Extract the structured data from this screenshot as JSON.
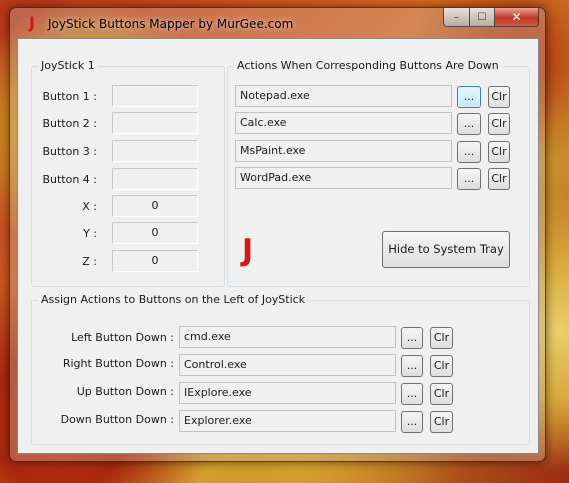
{
  "window": {
    "title": "JoyStick Buttons Mapper by MurGee.com",
    "app_icon": "J"
  },
  "caption": {
    "minimize": "–",
    "maximize": "☐",
    "close": "✕"
  },
  "joystick": {
    "label": "JoyStick 1",
    "buttons": [
      "Button 1 :",
      "Button 2 :",
      "Button 3 :",
      "Button 4 :"
    ],
    "axes": [
      {
        "label": "X :",
        "value": "0"
      },
      {
        "label": "Y :",
        "value": "0"
      },
      {
        "label": "Z :",
        "value": "0"
      }
    ]
  },
  "actions": {
    "label": "Actions When Corresponding Buttons Are Down",
    "rows": [
      {
        "value": "Notepad.exe",
        "browse": "...",
        "clear": "Clr"
      },
      {
        "value": "Calc.exe",
        "browse": "...",
        "clear": "Clr"
      },
      {
        "value": "MsPaint.exe",
        "browse": "...",
        "clear": "Clr"
      },
      {
        "value": "WordPad.exe",
        "browse": "...",
        "clear": "Clr"
      }
    ],
    "logo": "J",
    "hide_button": "Hide to System Tray"
  },
  "left_actions": {
    "label": "Assign Actions to Buttons on the Left of JoyStick",
    "rows": [
      {
        "label": "Left Button Down :",
        "value": "cmd.exe",
        "browse": "...",
        "clear": "Clr"
      },
      {
        "label": "Right Button Down :",
        "value": "Control.exe",
        "browse": "...",
        "clear": "Clr"
      },
      {
        "label": "Up Button Down :",
        "value": "IExplore.exe",
        "browse": "...",
        "clear": "Clr"
      },
      {
        "label": "Down Button Down :",
        "value": "Explorer.exe",
        "browse": "...",
        "clear": "Clr"
      }
    ]
  }
}
